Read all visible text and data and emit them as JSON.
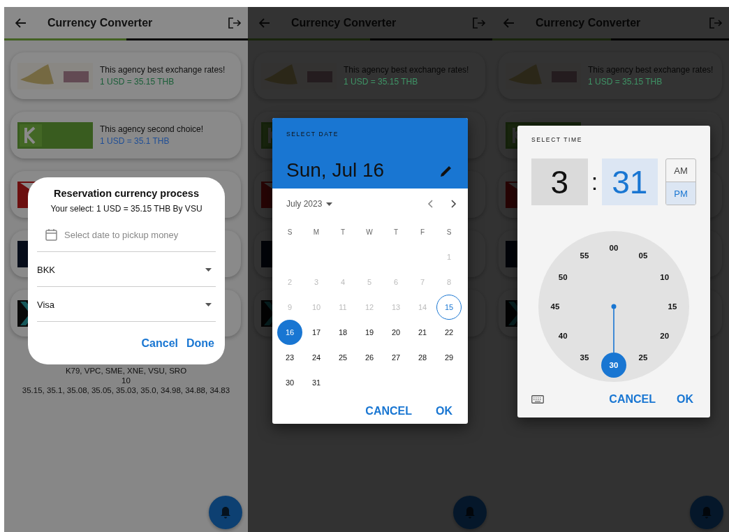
{
  "screens": [
    {
      "kind": "reservation",
      "app_bar": {
        "title": "Currency Converter",
        "level": 0.5
      },
      "cards": [
        {
          "logo": {
            "kind": "vasu"
          },
          "text": "This agency best exchange rates!",
          "rate": "1 USD = 35.15 THB",
          "color": "#1a5e38"
        },
        {
          "logo": {
            "kind": "k79"
          },
          "text": "This agency second choice!",
          "rate": "1 USD = 35.1 THB",
          "color": "#1f4e96"
        },
        {
          "logo": {
            "kind": "red"
          }
        },
        {
          "logo": {
            "kind": "navy"
          }
        },
        {
          "logo": {
            "kind": "x"
          }
        }
      ],
      "summary": [
        "K79, VPC, SME, XNE, VSU, SRO",
        "10",
        "35.15, 35.1, 35.08, 35.05, 35.03, 35.0, 34.98, 34.88, 34.83"
      ],
      "dialog": {
        "title": "Reservation currency process",
        "subtitle": "Your select: 1 USD = 35.15 THB By VSU",
        "date_field": {
          "placeholder": "Select date to pickup money"
        },
        "dropdowns": [
          {
            "value": "BKK"
          },
          {
            "value": "Visa"
          }
        ],
        "buttons": [
          "Cancel",
          "Done"
        ]
      }
    },
    {
      "kind": "date_picker",
      "app_bar": {
        "title": "Currency Converter",
        "level": 0.5
      },
      "cards": [
        {
          "logo": {
            "kind": "vasu"
          },
          "text": "This agency best exchange rates!",
          "rate": "1 USD = 35.15 THB",
          "color": "#3f9466"
        },
        {
          "logo": {
            "kind": "k79"
          }
        },
        {
          "logo": {
            "kind": "red"
          }
        },
        {
          "logo": {
            "kind": "navy"
          }
        },
        {
          "logo": {
            "kind": "x"
          }
        }
      ],
      "dialog": {
        "label": "SELECT DATE",
        "date": "Sun, Jul 16",
        "month": "July 2023",
        "weekdays": [
          "S",
          "M",
          "T",
          "W",
          "T",
          "F",
          "S"
        ],
        "weeks": [
          {
            "kind": "tail",
            "days": [
              {
                "label": "1",
                "disabled": true,
                "selected": false,
                "today": false
              }
            ]
          },
          {
            "kind": "full",
            "days": [
              {
                "label": "2",
                "disabled": true,
                "selected": false,
                "today": false
              },
              {
                "label": "3",
                "disabled": true,
                "selected": false,
                "today": false
              },
              {
                "label": "4",
                "disabled": true,
                "selected": false,
                "today": false
              },
              {
                "label": "5",
                "disabled": true,
                "selected": false,
                "today": false
              },
              {
                "label": "6",
                "disabled": true,
                "selected": false,
                "today": false
              },
              {
                "label": "7",
                "disabled": true,
                "selected": false,
                "today": false
              },
              {
                "label": "8",
                "disabled": true,
                "selected": false,
                "today": false
              }
            ]
          },
          {
            "kind": "full",
            "days": [
              {
                "label": "9",
                "disabled": true,
                "selected": false,
                "today": false
              },
              {
                "label": "10",
                "disabled": true,
                "selected": false,
                "today": false
              },
              {
                "label": "11",
                "disabled": true,
                "selected": false,
                "today": false
              },
              {
                "label": "12",
                "disabled": true,
                "selected": false,
                "today": false
              },
              {
                "label": "13",
                "disabled": true,
                "selected": false,
                "today": false
              },
              {
                "label": "14",
                "disabled": true,
                "selected": false,
                "today": false
              },
              {
                "label": "15",
                "disabled": false,
                "selected": false,
                "today": true
              }
            ]
          },
          {
            "kind": "full",
            "days": [
              {
                "label": "16",
                "disabled": false,
                "selected": true,
                "today": false
              },
              {
                "label": "17",
                "disabled": false,
                "selected": false,
                "today": false
              },
              {
                "label": "18",
                "disabled": false,
                "selected": false,
                "today": false
              },
              {
                "label": "19",
                "disabled": false,
                "selected": false,
                "today": false
              },
              {
                "label": "20",
                "disabled": false,
                "selected": false,
                "today": false
              },
              {
                "label": "21",
                "disabled": false,
                "selected": false,
                "today": false
              },
              {
                "label": "22",
                "disabled": false,
                "selected": false,
                "today": false
              }
            ]
          },
          {
            "kind": "full",
            "days": [
              {
                "label": "23",
                "disabled": false,
                "selected": false,
                "today": false
              },
              {
                "label": "24",
                "disabled": false,
                "selected": false,
                "today": false
              },
              {
                "label": "25",
                "disabled": false,
                "selected": false,
                "today": false
              },
              {
                "label": "26",
                "disabled": false,
                "selected": false,
                "today": false
              },
              {
                "label": "27",
                "disabled": false,
                "selected": false,
                "today": false
              },
              {
                "label": "28",
                "disabled": false,
                "selected": false,
                "today": false
              },
              {
                "label": "29",
                "disabled": false,
                "selected": false,
                "today": false
              }
            ]
          },
          {
            "kind": "head",
            "days": [
              {
                "label": "30",
                "disabled": false,
                "selected": false,
                "today": false
              },
              {
                "label": "31",
                "disabled": false,
                "selected": false,
                "today": false
              }
            ]
          }
        ],
        "buttons": [
          "CANCEL",
          "OK"
        ]
      }
    },
    {
      "kind": "time_picker",
      "app_bar": {
        "title": "Currency Converter",
        "level": 0.5
      },
      "cards": [
        {
          "logo": {
            "kind": "vasu"
          },
          "text": "This agency best exchange rates!",
          "rate": "1 USD = 35.15 THB",
          "color": "#3f9466"
        },
        {
          "logo": {
            "kind": "k79"
          }
        },
        {
          "logo": {
            "kind": "red"
          }
        },
        {
          "logo": {
            "kind": "navy"
          }
        },
        {
          "logo": {
            "kind": "x"
          }
        }
      ],
      "dialog": {
        "label": "SELECT TIME",
        "hour": {
          "value": "3",
          "selected": false
        },
        "separator": ":",
        "minute": {
          "value": "31",
          "selected": true
        },
        "periods": [
          {
            "label": "AM",
            "selected": false
          },
          {
            "label": "PM",
            "selected": true
          }
        ],
        "dial": {
          "labels": [
            {
              "label": "00",
              "selected": false
            },
            {
              "label": "05",
              "selected": false
            },
            {
              "label": "10",
              "selected": false
            },
            {
              "label": "15",
              "selected": false
            },
            {
              "label": "20",
              "selected": false
            },
            {
              "label": "25",
              "selected": false
            },
            {
              "label": "30",
              "selected": true
            },
            {
              "label": "35",
              "selected": false
            },
            {
              "label": "40",
              "selected": false
            },
            {
              "label": "45",
              "selected": false
            },
            {
              "label": "50",
              "selected": false
            },
            {
              "label": "55",
              "selected": false
            }
          ]
        },
        "buttons": [
          "CANCEL",
          "OK"
        ]
      }
    }
  ]
}
